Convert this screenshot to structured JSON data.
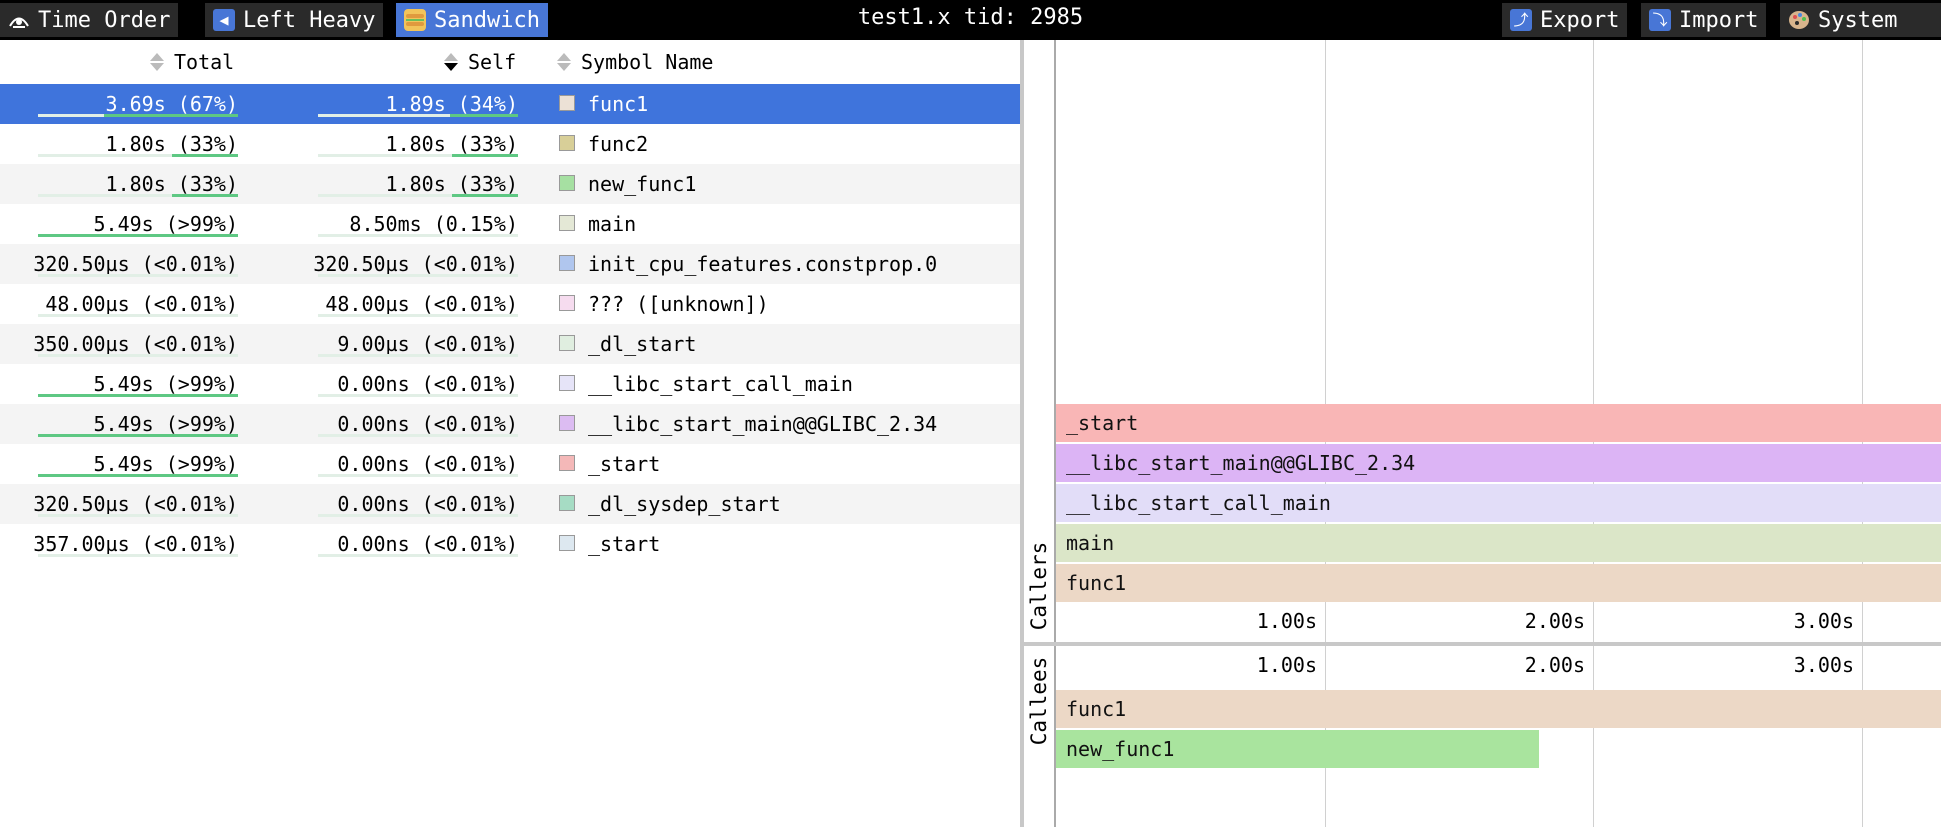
{
  "toolbar": {
    "buttons": [
      {
        "label": "Time Order",
        "icon": "eye-icon"
      },
      {
        "label": "Left Heavy",
        "icon": "arrow-left-icon"
      },
      {
        "label": "Sandwich",
        "icon": "sandwich-icon"
      }
    ],
    "title": "test1.x tid: 2985",
    "right_buttons": [
      {
        "label": "Export",
        "icon": "export-icon"
      },
      {
        "label": "Import",
        "icon": "import-icon"
      },
      {
        "label": "System",
        "icon": "palette-icon"
      }
    ]
  },
  "table": {
    "headers": {
      "total": "Total",
      "self": "Self",
      "symbol": "Symbol Name"
    },
    "sorted_by": "Self",
    "rows": [
      {
        "total": "3.69s (67%)",
        "total_frac": 0.67,
        "self": "1.89s (34%)",
        "self_frac": 0.34,
        "name": "func1",
        "color": "#ece1d6",
        "selected": true
      },
      {
        "total": "1.80s (33%)",
        "total_frac": 0.33,
        "self": "1.80s (33%)",
        "self_frac": 0.33,
        "name": "func2",
        "color": "#d8cf98"
      },
      {
        "total": "1.80s (33%)",
        "total_frac": 0.33,
        "self": "1.80s (33%)",
        "self_frac": 0.33,
        "name": "new_func1",
        "color": "#a6e0a2"
      },
      {
        "total": "5.49s (>99%)",
        "total_frac": 1.0,
        "self": "8.50ms (0.15%)",
        "self_frac": 0.0015,
        "name": "main",
        "color": "#e4e8d6"
      },
      {
        "total": "320.50µs (<0.01%)",
        "total_frac": 0.0001,
        "self": "320.50µs (<0.01%)",
        "self_frac": 0.0001,
        "name": "init_cpu_features.constprop.0",
        "color": "#b0c6ee"
      },
      {
        "total": "48.00µs (<0.01%)",
        "total_frac": 0.0001,
        "self": "48.00µs (<0.01%)",
        "self_frac": 0.0001,
        "name": "??? ([unknown])",
        "color": "#f6dcef"
      },
      {
        "total": "350.00µs (<0.01%)",
        "total_frac": 0.0001,
        "self": "9.00µs (<0.01%)",
        "self_frac": 0.0001,
        "name": "_dl_start",
        "color": "#e0eee0"
      },
      {
        "total": "5.49s (>99%)",
        "total_frac": 1.0,
        "self": "0.00ns (<0.01%)",
        "self_frac": 0.0,
        "name": "__libc_start_call_main",
        "color": "#e6e4f8"
      },
      {
        "total": "5.49s (>99%)",
        "total_frac": 1.0,
        "self": "0.00ns (<0.01%)",
        "self_frac": 0.0,
        "name": "__libc_start_main@@GLIBC_2.34",
        "color": "#dcbcf2"
      },
      {
        "total": "5.49s (>99%)",
        "total_frac": 1.0,
        "self": "0.00ns (<0.01%)",
        "self_frac": 0.0,
        "name": "_start",
        "color": "#f4b8b8"
      },
      {
        "total": "320.50µs (<0.01%)",
        "total_frac": 0.0001,
        "self": "0.00ns (<0.01%)",
        "self_frac": 0.0,
        "name": "_dl_sysdep_start",
        "color": "#a6dcc4"
      },
      {
        "total": "357.00µs (<0.01%)",
        "total_frac": 0.0001,
        "self": "0.00ns (<0.01%)",
        "self_frac": 0.0,
        "name": "_start",
        "color": "#dde8f0"
      }
    ]
  },
  "callers": {
    "label": "Callers",
    "frames": [
      {
        "name": "_start",
        "color": "#f9b6b6",
        "start": 0,
        "end": 3.69
      },
      {
        "name": "__libc_start_main@@GLIBC_2.34",
        "color": "#dcb4f5",
        "start": 0,
        "end": 3.69
      },
      {
        "name": "__libc_start_call_main",
        "color": "#e2ddf8",
        "start": 0,
        "end": 3.69
      },
      {
        "name": "main",
        "color": "#dbe6c8",
        "start": 0,
        "end": 3.69
      },
      {
        "name": "func1",
        "color": "#ecd8c6",
        "start": 0,
        "end": 3.69
      }
    ],
    "ticks": [
      "1.00s",
      "2.00s",
      "3.00s"
    ]
  },
  "callees": {
    "label": "Callees",
    "ticks": [
      "1.00s",
      "2.00s",
      "3.00s"
    ],
    "frames": [
      {
        "name": "func1",
        "color": "#ecd8c6",
        "start": 0,
        "end": 3.69
      },
      {
        "name": "new_func1",
        "color": "#a9e49e",
        "start": 0,
        "end": 1.8
      }
    ]
  }
}
